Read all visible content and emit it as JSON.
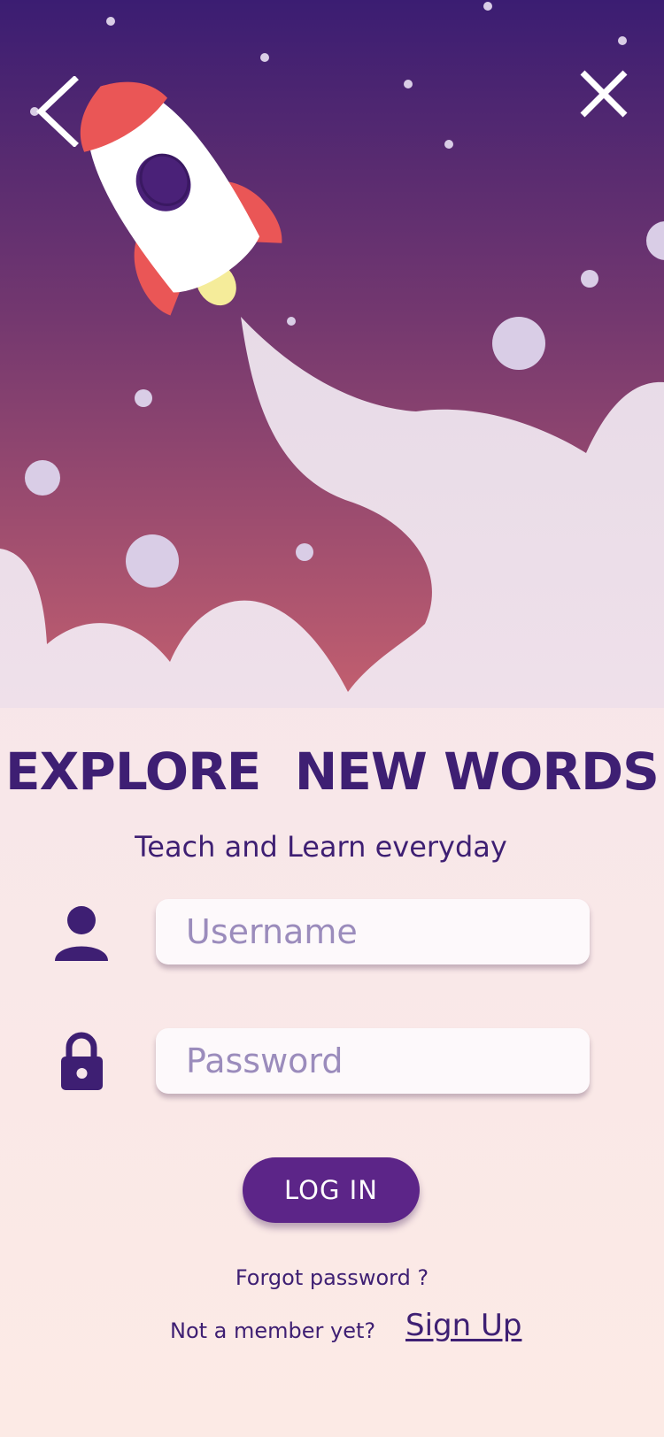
{
  "header": {
    "back_icon": "chevron-left-icon",
    "close_icon": "close-icon"
  },
  "hero": {
    "illustration": "rocket-launch",
    "colors": {
      "sky_top": "#3b1d72",
      "sky_mid": "#74386f",
      "sky_bottom": "#c4606f",
      "smoke": "#eadde7",
      "rocket_fin": "#ea5656",
      "rocket_window": "#4a2178",
      "flame": "#f5ec9a"
    }
  },
  "heading": {
    "title": "EXPLORE  NEW WORDS",
    "subtitle": "Teach and Learn everyday"
  },
  "form": {
    "username": {
      "icon": "user-icon",
      "placeholder": "Username",
      "value": ""
    },
    "password": {
      "icon": "lock-icon",
      "placeholder": "Password",
      "value": ""
    },
    "login_label": "LOG IN"
  },
  "footer": {
    "forgot_label": "Forgot password ?",
    "member_text": "Not a member yet?",
    "signup_label": "Sign Up"
  },
  "colors": {
    "primary": "#3e1f73",
    "button": "#5c2588",
    "input_bg": "#fdf9fb",
    "placeholder": "#9b8cbc"
  }
}
